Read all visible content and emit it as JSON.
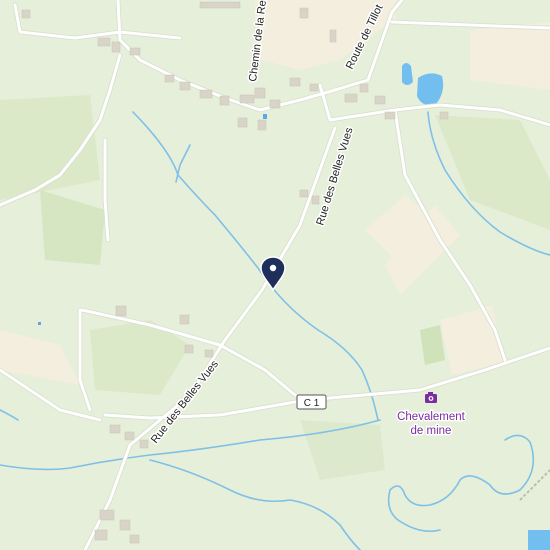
{
  "map": {
    "colors": {
      "land": "#e6efd9",
      "field_light": "#f3eedd",
      "field_green": "#d8e8c6",
      "water": "#7ec0e8",
      "lake": "#72bfef",
      "road": "#ffffff",
      "building": "#d9d4c8",
      "poi": "#7a2d9e",
      "marker": "#1f2f5c"
    },
    "streets": [
      {
        "name": "Chemin de la Rechotte"
      },
      {
        "name": "Route de Tillot"
      },
      {
        "name": "Rue des Belles Vues"
      },
      {
        "name": "Rue des Belles Vues"
      }
    ],
    "road_shield": {
      "ref": "C 1"
    },
    "poi": {
      "icon": "camera-icon",
      "label_line1": "Chevalement",
      "label_line2": "de mine"
    },
    "marker": {
      "icon": "location-pin-icon"
    }
  }
}
